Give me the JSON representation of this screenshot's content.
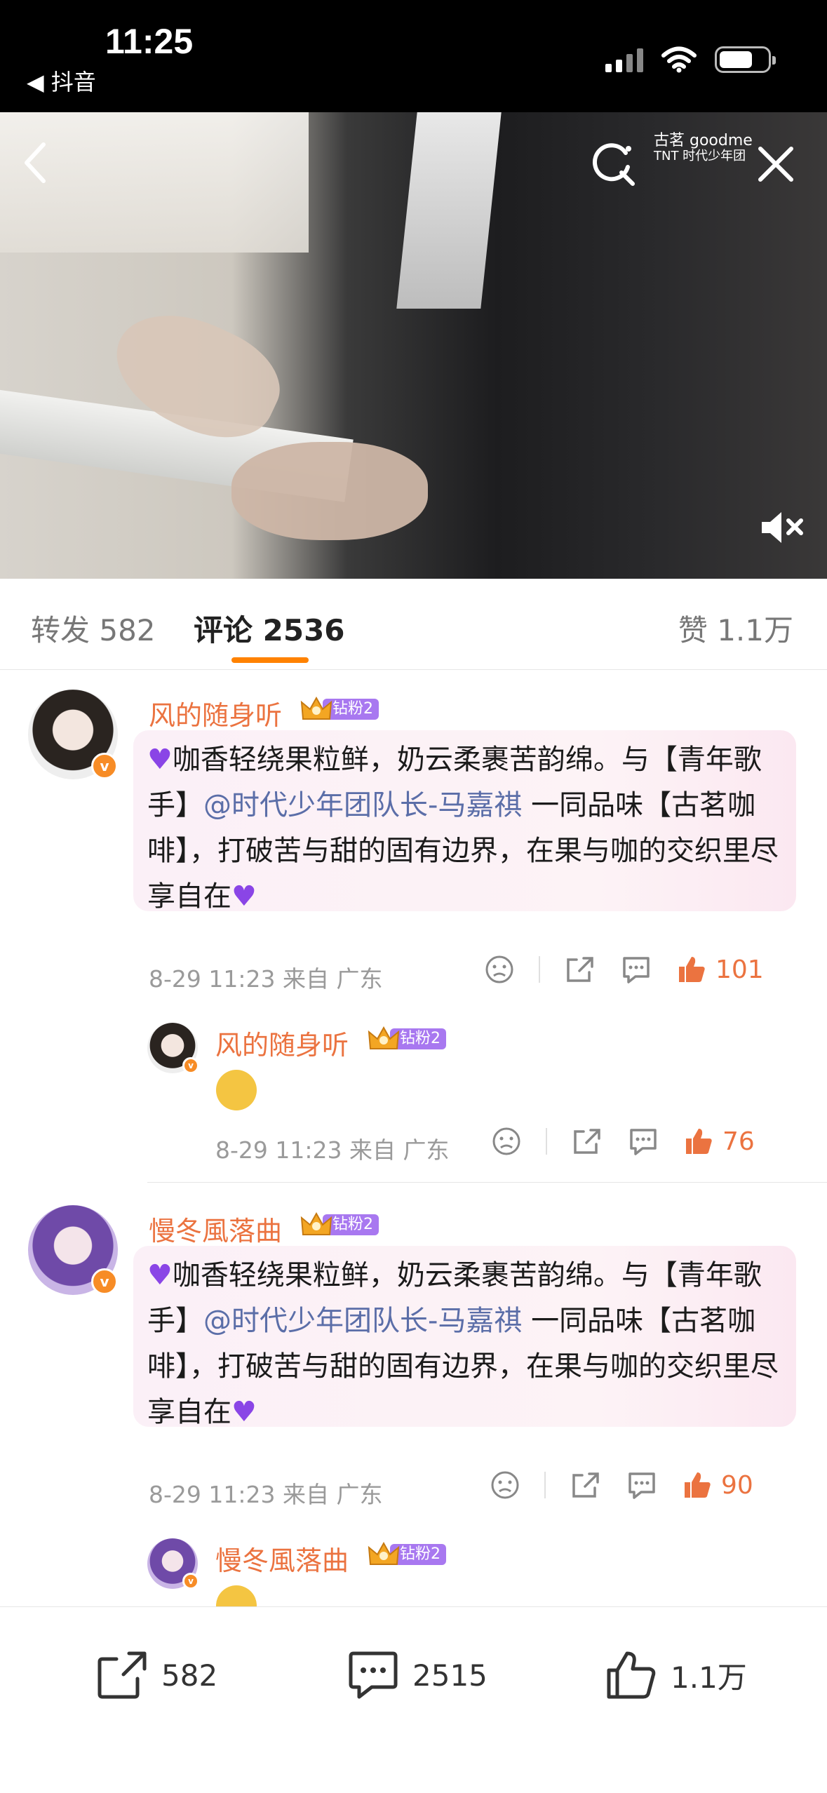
{
  "status_bar": {
    "time": "11:25",
    "back_app": "◀ 抖音"
  },
  "video": {
    "brand_text": "古茗 goodme",
    "brand_text2": "TNT 时代少年团"
  },
  "tabs": {
    "forward": "转发 582",
    "comment": "评论 2536",
    "like": "赞 1.1万",
    "accent_color": "#FF8200"
  },
  "comments": [
    {
      "user": "风的随身听",
      "badge": "钻粉2",
      "text_before": "咖香轻绕果粒鲜，奶云柔裹苦韵绵。与【青年歌手】",
      "mention": "@时代少年团队长-马嘉祺",
      "text_after": " 一同品味【古茗咖啡】，打破苦与甜的固有边界，在果与咖的交织里尽享自在",
      "meta": "8-29 11:23 来自 广东",
      "likes": "101",
      "reply": {
        "user": "风的随身听",
        "badge": "钻粉2",
        "meta": "8-29 11:23 来自 广东",
        "likes": "76"
      }
    },
    {
      "user": "慢冬風落曲",
      "badge": "钻粉2",
      "text_before": "咖香轻绕果粒鲜，奶云柔裹苦韵绵。与【青年歌手】",
      "mention": "@时代少年团队长-马嘉祺",
      "text_after": " 一同品味【古茗咖啡】，打破苦与甜的固有边界，在果与咖的交织里尽享自在",
      "meta": "8-29 11:23 来自 广东",
      "likes": "90",
      "reply": {
        "user": "慢冬風落曲",
        "badge": "钻粉2"
      }
    }
  ],
  "bottom_bar": {
    "repost": "582",
    "comment": "2515",
    "like": "1.1万"
  },
  "colors": {
    "username": "#EB7340",
    "mention": "#5B6EA8",
    "like_active": "#EB7340"
  }
}
